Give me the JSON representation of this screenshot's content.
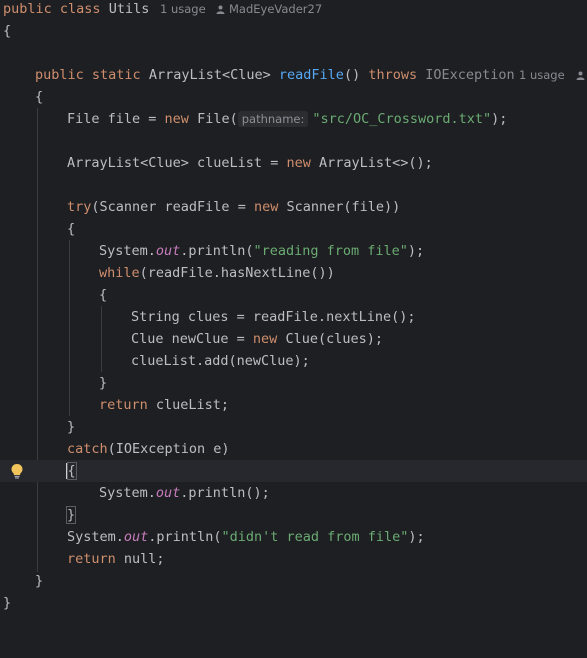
{
  "colors": {
    "background": "#1e1f22",
    "keyword": "#cf8e6d",
    "string": "#6aab73",
    "method_decl": "#56a8f5",
    "static_field": "#c77dbb",
    "text": "#bcbec4"
  },
  "header": {
    "kw1": "public",
    "kw2": "class",
    "name": "Utils",
    "usage": "1 usage",
    "author": "MadEyeVader27",
    "author_icon": "person-icon"
  },
  "l_class_open": "{",
  "method": {
    "kw1": "public",
    "kw2": "static",
    "type": "ArrayList<Clue>",
    "name": "readFile",
    "params": "()",
    "throws": "throws",
    "exception": "IOException",
    "usage": "1 usage",
    "usage_icon": "person-icon"
  },
  "l_method_open": "{",
  "file_line": {
    "p1": "File file = ",
    "kw": "new",
    "p2": " File(",
    "hint": "pathname:",
    "str": "\"src/OC_Crossword.txt\"",
    "p3": ");"
  },
  "list_line": {
    "p1": "ArrayList<Clue> clueList = ",
    "kw": "new",
    "p2": " ArrayList<>();"
  },
  "try_line": {
    "kw": "try",
    "p1": "(Scanner readFile = ",
    "kw2": "new",
    "p2": " Scanner(file))"
  },
  "l_try_open": "{",
  "print1": {
    "p1": "System.",
    "field": "out",
    "p2": ".println(",
    "str": "\"reading from file\"",
    "p3": ");"
  },
  "while_line": {
    "kw": "while",
    "p1": "(readFile.hasNextLine())"
  },
  "l_while_open": "{",
  "clues_line": "String clues = readFile.nextLine();",
  "clue_line": {
    "p1": "Clue newClue = ",
    "kw": "new",
    "p2": " Clue(clues);"
  },
  "add_line": "clueList.add(newClue);",
  "l_while_close": "}",
  "return1": {
    "kw": "return",
    "p1": " clueList;"
  },
  "l_try_close": "}",
  "catch_line": {
    "kw": "catch",
    "p1": "(IOException e)"
  },
  "l_catch_open": "{",
  "print2": {
    "p1": "System.",
    "field": "out",
    "p2": ".println();"
  },
  "l_catch_close": "}",
  "print3": {
    "p1": "System.",
    "field": "out",
    "p2": ".println(",
    "str": "\"didn't read from file\"",
    "p3": ");"
  },
  "return2": {
    "kw": "return",
    "p1": " null;"
  },
  "l_method_close": "}",
  "l_class_close": "}",
  "gutter": {
    "intention_icon": "lightbulb-icon"
  }
}
